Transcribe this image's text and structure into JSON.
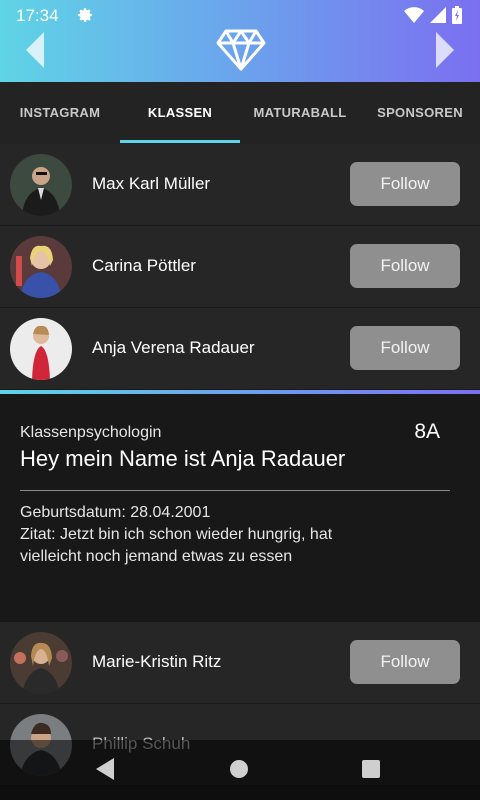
{
  "status_bar": {
    "time": "17:34"
  },
  "tabs": [
    {
      "label": "INSTAGRAM"
    },
    {
      "label": "KLASSEN"
    },
    {
      "label": "MATURABALL"
    },
    {
      "label": "SPONSOREN"
    }
  ],
  "active_tab": "KLASSEN",
  "people": [
    {
      "name": "Max Karl Müller",
      "follow_label": "Follow"
    },
    {
      "name": "Carina Pöttler",
      "follow_label": "Follow"
    },
    {
      "name": "Anja Verena Radauer",
      "follow_label": "Follow"
    },
    {
      "name": "Marie-Kristin Ritz",
      "follow_label": "Follow"
    },
    {
      "name": "Phillip Schuh"
    }
  ],
  "detail": {
    "role": "Klassenpsychologin",
    "class": "8A",
    "title": "Hey mein Name ist Anja Radauer",
    "birthdate_line": "Geburtsdatum: 28.04.2001",
    "quote_line": "Zitat: Jetzt bin ich schon wieder hungrig, hat vielleicht noch jemand etwas zu essen"
  },
  "colors": {
    "header_gradient_start": "#5fd4e6",
    "header_gradient_end": "#7b6ff0",
    "tab_indicator": "#5fd4e6",
    "follow_button": "#8f8f8f"
  }
}
